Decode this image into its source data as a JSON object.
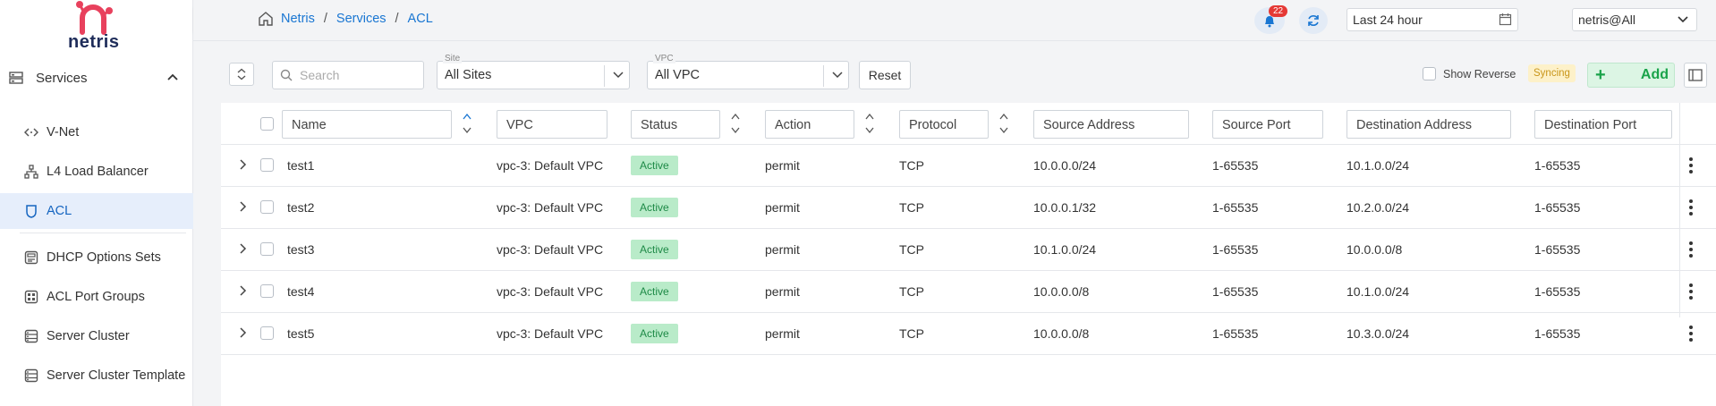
{
  "brand": {
    "name": "netris"
  },
  "sidebar": {
    "section": "Services",
    "items": [
      {
        "label": "V-Net",
        "icon": "code-brackets-icon"
      },
      {
        "label": "L4 Load Balancer",
        "icon": "hierarchy-icon"
      },
      {
        "label": "ACL",
        "icon": "shield-icon",
        "active": true
      },
      {
        "label": "DHCP Options Sets",
        "icon": "dhcp-icon"
      },
      {
        "label": "ACL Port Groups",
        "icon": "port-group-icon"
      },
      {
        "label": "Server Cluster",
        "icon": "server-icon"
      },
      {
        "label": "Server Cluster Template",
        "icon": "server-icon"
      }
    ]
  },
  "breadcrumb": [
    "Netris",
    "Services",
    "ACL"
  ],
  "header": {
    "notifications": "22",
    "time_range": "Last 24 hour",
    "tenant": "netris@All"
  },
  "toolbar": {
    "search_placeholder": "Search",
    "site_label": "Site",
    "site_value": "All Sites",
    "vpc_label": "VPC",
    "vpc_value": "All VPC",
    "reset_label": "Reset",
    "show_reverse_label": "Show Reverse",
    "sync_status": "Syncing",
    "add_label": "Add",
    "add_plus": "+"
  },
  "table": {
    "columns": [
      "Name",
      "VPC",
      "Status",
      "Action",
      "Protocol",
      "Source Address",
      "Source Port",
      "Destination Address",
      "Destination Port"
    ],
    "rows": [
      {
        "name": "test1",
        "vpc": "vpc-3: Default VPC",
        "status": "Active",
        "action": "permit",
        "protocol": "TCP",
        "src_addr": "10.0.0.0/24",
        "src_port": "1-65535",
        "dst_addr": "10.1.0.0/24",
        "dst_port": "1-65535"
      },
      {
        "name": "test2",
        "vpc": "vpc-3: Default VPC",
        "status": "Active",
        "action": "permit",
        "protocol": "TCP",
        "src_addr": "10.0.0.1/32",
        "src_port": "1-65535",
        "dst_addr": "10.2.0.0/24",
        "dst_port": "1-65535"
      },
      {
        "name": "test3",
        "vpc": "vpc-3: Default VPC",
        "status": "Active",
        "action": "permit",
        "protocol": "TCP",
        "src_addr": "10.1.0.0/24",
        "src_port": "1-65535",
        "dst_addr": "10.0.0.0/8",
        "dst_port": "1-65535"
      },
      {
        "name": "test4",
        "vpc": "vpc-3: Default VPC",
        "status": "Active",
        "action": "permit",
        "protocol": "TCP",
        "src_addr": "10.0.0.0/8",
        "src_port": "1-65535",
        "dst_addr": "10.1.0.0/24",
        "dst_port": "1-65535"
      },
      {
        "name": "test5",
        "vpc": "vpc-3: Default VPC",
        "status": "Active",
        "action": "permit",
        "protocol": "TCP",
        "src_addr": "10.0.0.0/8",
        "src_port": "1-65535",
        "dst_addr": "10.3.0.0/24",
        "dst_port": "1-65535"
      }
    ]
  },
  "colors": {
    "accent": "#1976d2",
    "active_bg": "#e6eefb",
    "status_green_bg": "#b9ebc9",
    "status_green_text": "#1e8a47",
    "brand_pink": "#e8415d",
    "brand_navy": "#1f2d5a",
    "add_green": "#1aa34a",
    "syncing_bg": "#fdf1c9"
  }
}
